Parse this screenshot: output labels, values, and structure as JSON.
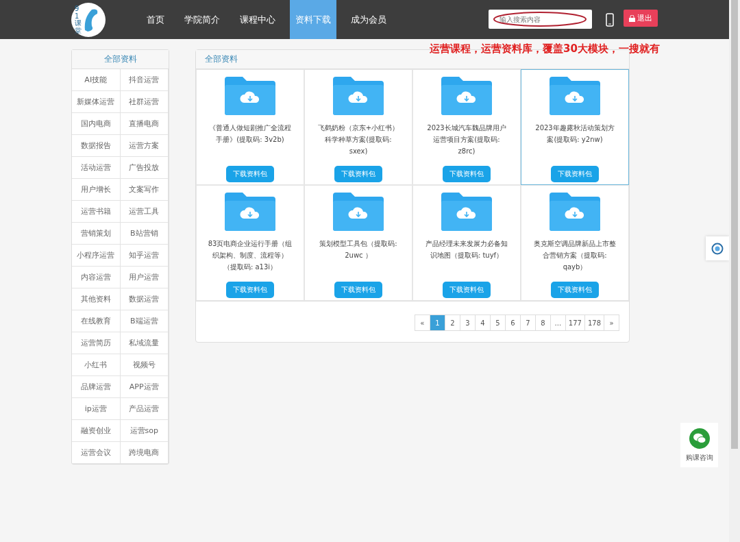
{
  "header": {
    "logo_text": "91课堂",
    "nav": [
      {
        "label": "首页",
        "selected": false
      },
      {
        "label": "学院简介",
        "selected": false
      },
      {
        "label": "课程中心",
        "selected": false
      },
      {
        "label": "资料下载",
        "selected": true
      },
      {
        "label": "成为会员",
        "selected": false
      }
    ],
    "search": {
      "placeholder": "输入搜索内容"
    },
    "logout": "退出"
  },
  "annotation": "运营课程，运营资料库，覆盖30大模块，一搜就有",
  "sidebar": {
    "title": "全部资料",
    "items": [
      "AI技能",
      "抖音运营",
      "新媒体运营",
      "社群运营",
      "国内电商",
      "直播电商",
      "数据报告",
      "运营方案",
      "活动运营",
      "广告投放",
      "用户增长",
      "文案写作",
      "运营书籍",
      "运营工具",
      "营销策划",
      "B站营销",
      "小程序运营",
      "知乎运营",
      "内容运营",
      "用户运营",
      "其他资料",
      "数据运营",
      "在线教育",
      "B端运营",
      "运营简历",
      "私域流量",
      "小红书",
      "视频号",
      "品牌运营",
      "APP运营",
      "ip运营",
      "产品运营",
      "融资创业",
      "运营sop",
      "运营会议",
      "跨境电商"
    ]
  },
  "main": {
    "title": "全部资料",
    "items": [
      {
        "title": "《普通人做短剧推广全流程手册》(提取码: 3v2b)",
        "button": "下载资料包",
        "highlighted": false
      },
      {
        "title": "飞鹤奶粉（京东+小红书）科学种草方案(提取码: sxex)",
        "button": "下载资料包",
        "highlighted": false
      },
      {
        "title": "2023长城汽车魏品牌用户运营项目方案(提取码: z8rc)",
        "button": "下载资料包",
        "highlighted": false
      },
      {
        "title": "2023年趣露秋活动策划方案(提取码: y2nw)",
        "button": "下载资料包",
        "highlighted": true
      },
      {
        "title": "83页电商企业运行手册（组织架构、制度、流程等）（提取码: a13i）",
        "button": "下载资料包",
        "highlighted": false
      },
      {
        "title": "策划模型工具包（提取码: 2uwc ）",
        "button": "下载资料包",
        "highlighted": false
      },
      {
        "title": "产品经理未来发展力必备知识地图（提取码: tuyf）",
        "button": "下载资料包",
        "highlighted": false
      },
      {
        "title": "奥克斯空调品牌新品上市整合营销方案（提取码: qayb）",
        "button": "下载资料包",
        "highlighted": false
      }
    ],
    "pagination": [
      {
        "label": "«",
        "selected": false
      },
      {
        "label": "1",
        "selected": true
      },
      {
        "label": "2",
        "selected": false
      },
      {
        "label": "3",
        "selected": false
      },
      {
        "label": "4",
        "selected": false
      },
      {
        "label": "5",
        "selected": false
      },
      {
        "label": "6",
        "selected": false
      },
      {
        "label": "7",
        "selected": false
      },
      {
        "label": "8",
        "selected": false
      },
      {
        "label": "...",
        "selected": false
      },
      {
        "label": "177",
        "selected": false
      },
      {
        "label": "178",
        "selected": false
      },
      {
        "label": "»",
        "selected": false
      }
    ]
  },
  "consult": {
    "label": "购课咨询"
  }
}
